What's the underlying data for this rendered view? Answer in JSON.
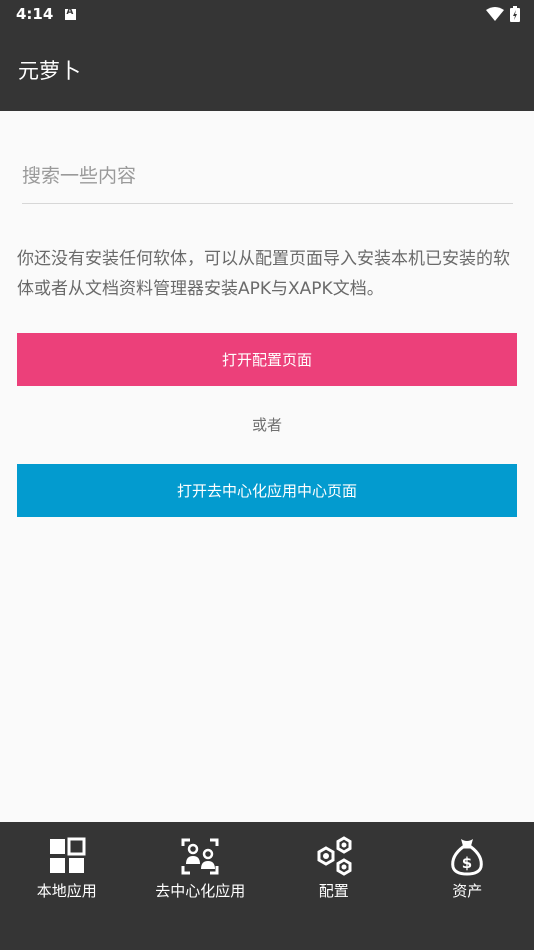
{
  "status_bar": {
    "time": "4:14"
  },
  "app_bar": {
    "title": "元萝卜"
  },
  "search": {
    "placeholder": "搜索一些内容"
  },
  "message": "你还没有安装任何软体，可以从配置页面导入安装本机已安装的软体或者从文档资料管理器安装APK与XAPK文档。",
  "buttons": {
    "open_config": "打开配置页面",
    "or": "或者",
    "open_center": "打开去中心化应用中心页面"
  },
  "colors": {
    "bar": "#353535",
    "pink": "#ec407a",
    "blue": "#039bcf"
  },
  "bottom_nav": [
    {
      "label": "本地应用",
      "icon": "grid-icon"
    },
    {
      "label": "去中心化应用",
      "icon": "nodes-icon"
    },
    {
      "label": "配置",
      "icon": "hexagons-icon"
    },
    {
      "label": "资产",
      "icon": "money-bag-icon"
    }
  ]
}
